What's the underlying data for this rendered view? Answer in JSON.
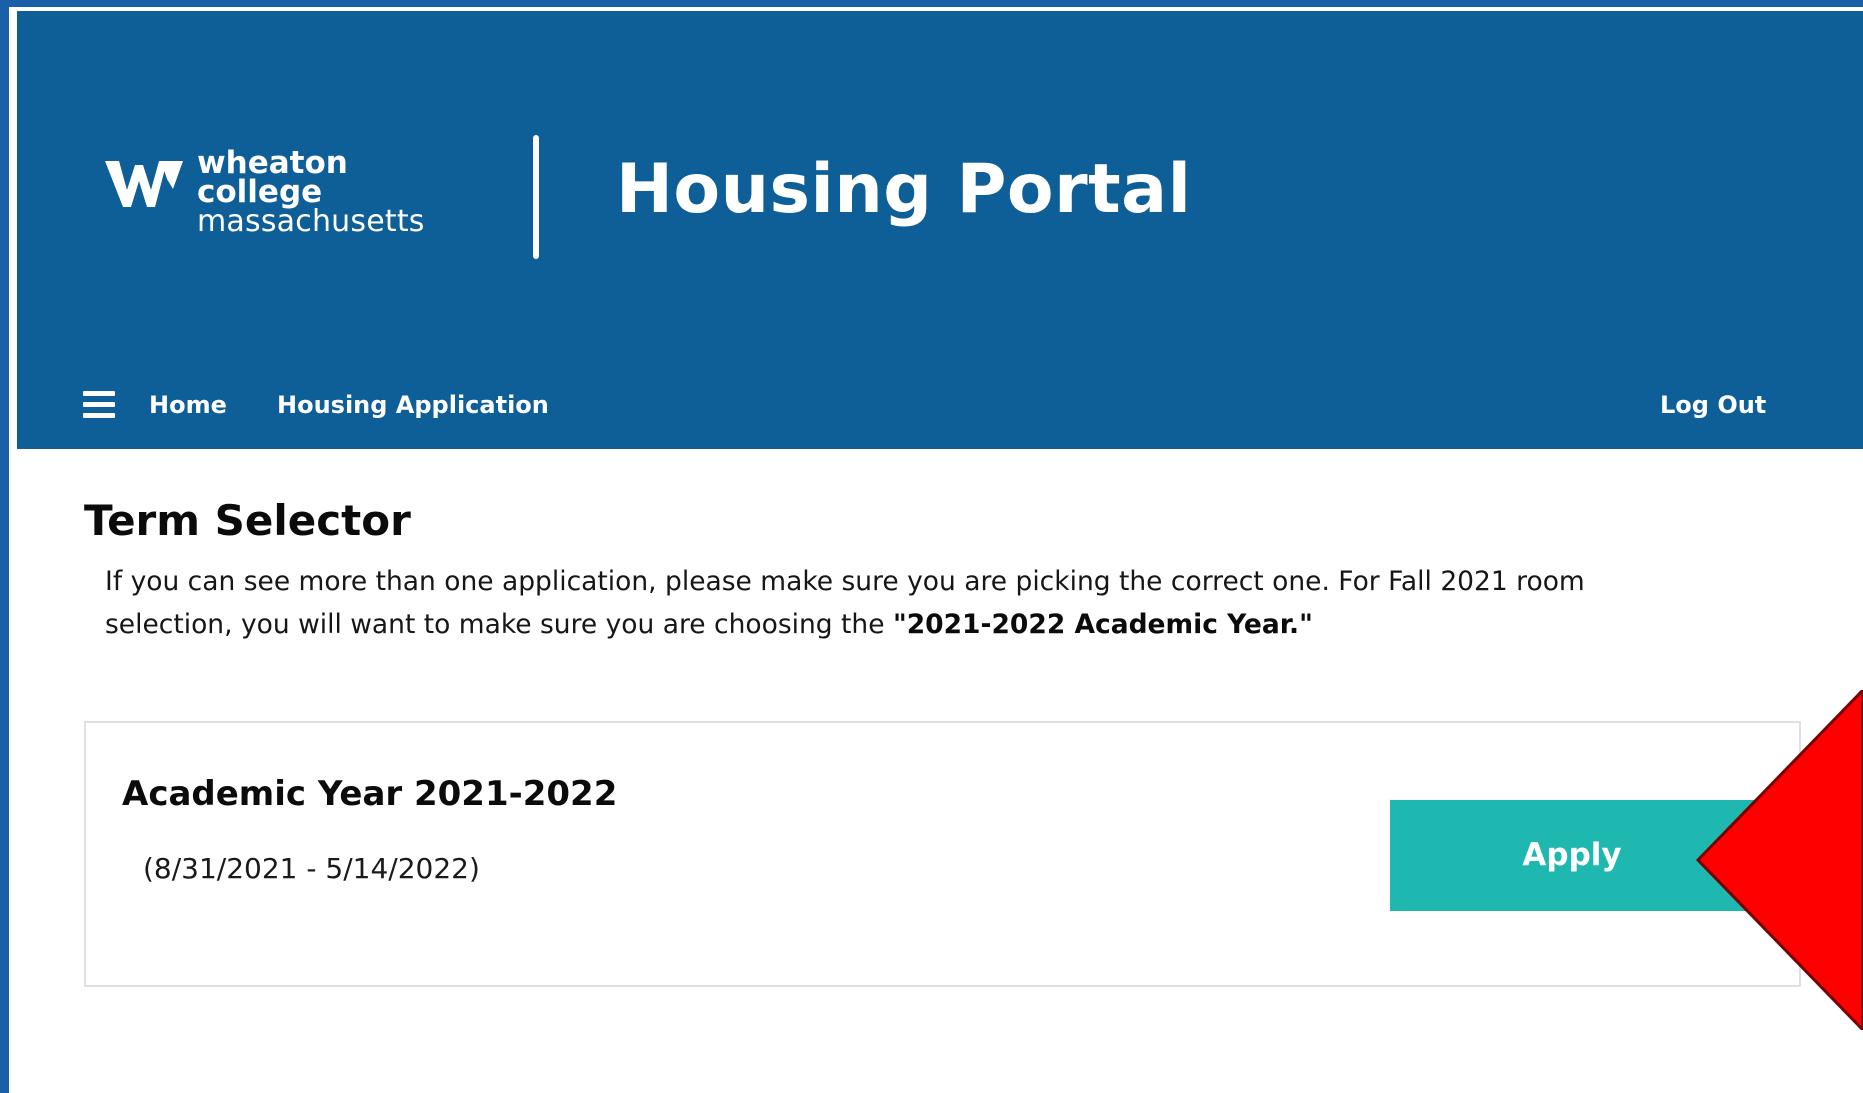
{
  "header": {
    "logo": {
      "mark": "W",
      "line1": "wheaton",
      "line2": "college",
      "line3": "massachusetts"
    },
    "title": "Housing Portal",
    "background_color": "#0e5e98"
  },
  "nav": {
    "menu_icon": "hamburger-menu-icon",
    "items": [
      {
        "label": "Home"
      },
      {
        "label": "Housing Application"
      }
    ],
    "logout_label": "Log Out"
  },
  "main": {
    "title": "Term Selector",
    "intro_text": "If you can see more than one application, please make sure you are picking the correct one. For Fall 2021 room selection, you will want to make sure you are choosing the ",
    "intro_emphasis": "\"2021-2022 Academic Year.\"",
    "terms": [
      {
        "name": "Academic Year 2021-2022",
        "dates": "(8/31/2021 - 5/14/2022)",
        "action_label": "Apply",
        "action_color": "#1fb8b0"
      }
    ]
  },
  "annotation": {
    "icon": "red-arrow-pointer-icon",
    "color": "#ff0000"
  }
}
